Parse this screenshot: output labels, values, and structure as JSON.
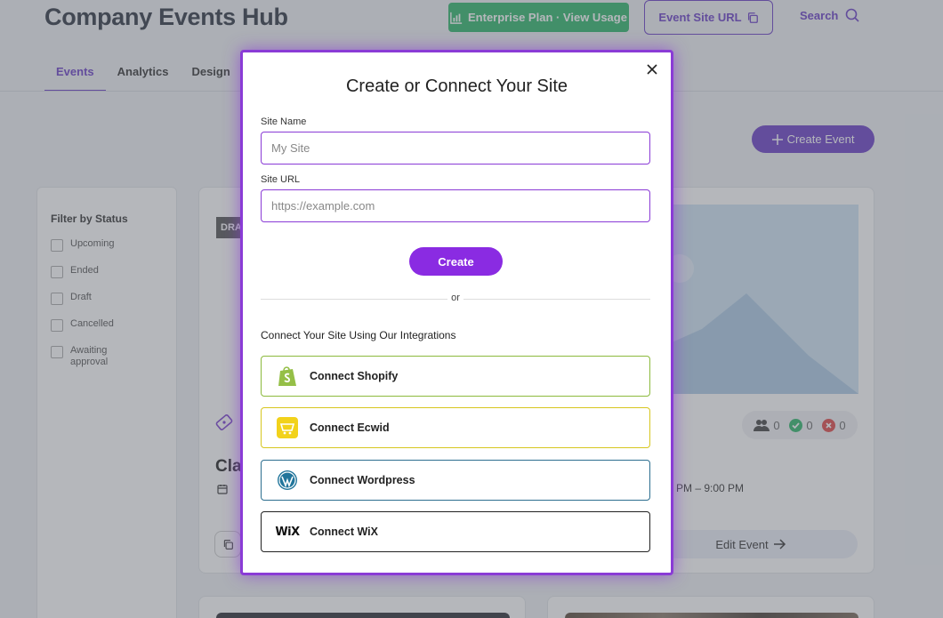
{
  "header": {
    "app_title": "Company Events Hub",
    "plan_button": "Enterprise Plan · View Usage",
    "site_url_button": "Event Site URL",
    "search_label": "Search"
  },
  "tabs": [
    {
      "label": "Events",
      "active": true
    },
    {
      "label": "Analytics",
      "active": false
    },
    {
      "label": "Design",
      "active": false
    }
  ],
  "toolbar": {
    "create_event": "Create Event"
  },
  "filter": {
    "title": "Filter by Status",
    "options": [
      "Upcoming",
      "Ended",
      "Draft",
      "Cancelled",
      "Awaiting approval"
    ]
  },
  "event_card": {
    "badge": "DRAFT",
    "title": "Class",
    "time_end": "PM – 9:00 PM",
    "stats": {
      "attending": "0",
      "approved": "0",
      "declined": "0"
    },
    "edit_button": "Edit Event"
  },
  "modal": {
    "title": "Create or Connect Your Site",
    "site_name_label": "Site Name",
    "site_name_placeholder": "My Site",
    "site_url_label": "Site URL",
    "site_url_placeholder": "https://example.com",
    "create_button": "Create",
    "or_text": "or",
    "integrations_title": "Connect Your Site Using Our Integrations",
    "integrations": {
      "shopify": "Connect Shopify",
      "ecwid": "Connect Ecwid",
      "wordpress": "Connect Wordpress",
      "wix": "Connect WiX",
      "wix_logo_text": "WiX"
    }
  },
  "colors": {
    "brand_purple": "#6a3fc7",
    "modal_purple": "#8a2be2",
    "plan_green": "#2fb66b",
    "shopify_green": "#95bf47",
    "ecwid_yellow": "#f2d21b",
    "wordpress_blue": "#21759b"
  },
  "icons": [
    "bar-chart-icon",
    "copy-icon",
    "search-icon",
    "plus-icon",
    "close-icon",
    "ticket-icon",
    "calendar-icon",
    "arrow-right-icon",
    "people-icon",
    "check-icon",
    "x-circle-icon",
    "shopify-logo",
    "ecwid-logo",
    "wordpress-logo",
    "wix-logo"
  ]
}
